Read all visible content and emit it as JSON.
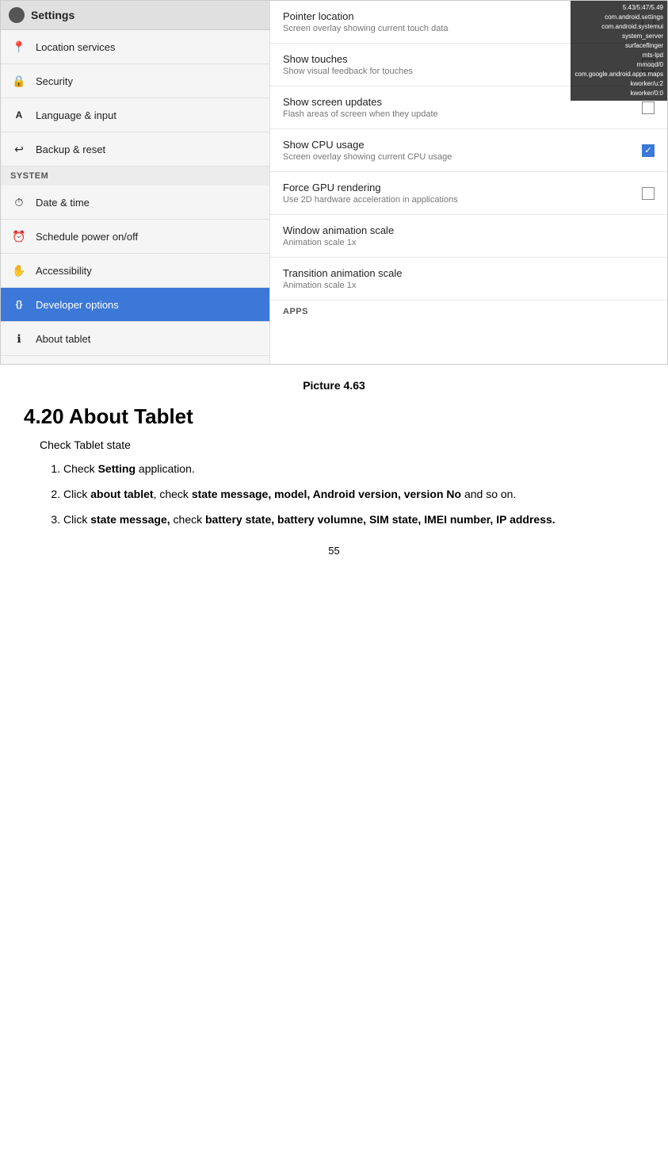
{
  "screenshot": {
    "sidebar": {
      "header_title": "Settings",
      "items_pre_system": [
        {
          "id": "location",
          "label": "Location services",
          "icon": "📍",
          "active": false
        },
        {
          "id": "security",
          "label": "Security",
          "icon": "🔒",
          "active": false
        },
        {
          "id": "language",
          "label": "Language & input",
          "icon": "A",
          "active": false
        },
        {
          "id": "backup",
          "label": "Backup & reset",
          "icon": "↩",
          "active": false
        }
      ],
      "system_section_label": "SYSTEM",
      "items_system": [
        {
          "id": "datetime",
          "label": "Date & time",
          "icon": "⏱",
          "active": false
        },
        {
          "id": "schedule",
          "label": "Schedule power on/off",
          "icon": "⚡",
          "active": false
        },
        {
          "id": "accessibility",
          "label": "Accessibility",
          "icon": "✋",
          "active": false
        },
        {
          "id": "developer",
          "label": "Developer options",
          "icon": "{}",
          "active": true
        },
        {
          "id": "about",
          "label": "About tablet",
          "icon": "ℹ",
          "active": false
        }
      ]
    },
    "right_panel": {
      "status_bar": {
        "line1": "5.43/5:47/5.49",
        "line2": "com.android.settings",
        "line3": "com.android.systemui",
        "line4": "system_server",
        "line5": "surfaceflinger",
        "line6": "mts-lpd",
        "line7": "mmoqd/0",
        "line8": "com.google.android.apps.maps",
        "line9": "kworker/u:2",
        "line10": "kworker/0:0"
      },
      "settings_items": [
        {
          "id": "pointer-location",
          "title": "Pointer location",
          "subtitle": "Screen overlay showing current touch data",
          "has_checkbox": true,
          "checked": false
        },
        {
          "id": "show-touches",
          "title": "Show touches",
          "subtitle": "Show visual feedback for touches",
          "has_checkbox": true,
          "checked": false
        },
        {
          "id": "show-screen-updates",
          "title": "Show screen updates",
          "subtitle": "Flash areas of screen when they update",
          "has_checkbox": true,
          "checked": false
        },
        {
          "id": "show-cpu-usage",
          "title": "Show CPU usage",
          "subtitle": "Screen overlay showing current CPU usage",
          "has_checkbox": true,
          "checked": true
        },
        {
          "id": "force-gpu",
          "title": "Force GPU rendering",
          "subtitle": "Use 2D hardware acceleration in applications",
          "has_checkbox": true,
          "checked": false
        },
        {
          "id": "window-animation",
          "title": "Window animation scale",
          "subtitle": "Animation scale 1x",
          "has_checkbox": false,
          "checked": false
        },
        {
          "id": "transition-animation",
          "title": "Transition animation scale",
          "subtitle": "Animation scale 1x",
          "has_checkbox": false,
          "checked": false
        }
      ],
      "apps_section_label": "APPS"
    }
  },
  "caption": "Picture 4.63",
  "section_heading": "4.20 About Tablet",
  "intro_text": "Check Tablet state",
  "list_items": [
    {
      "number": "1",
      "text_plain": "Check ",
      "text_bold": "Setting",
      "text_after": " application."
    },
    {
      "number": "2",
      "text_plain": "Click ",
      "text_bold": "about tablet",
      "text_after": ", check ",
      "text_bold2": "state message, model, Android version, version No",
      "text_after2": " and so on."
    },
    {
      "number": "3",
      "text_plain": "Click ",
      "text_bold": "state message,",
      "text_after": " check ",
      "text_bold2": "battery state, battery volumne, SIM state, IMEI number, IP address."
    }
  ],
  "page_number": "55"
}
